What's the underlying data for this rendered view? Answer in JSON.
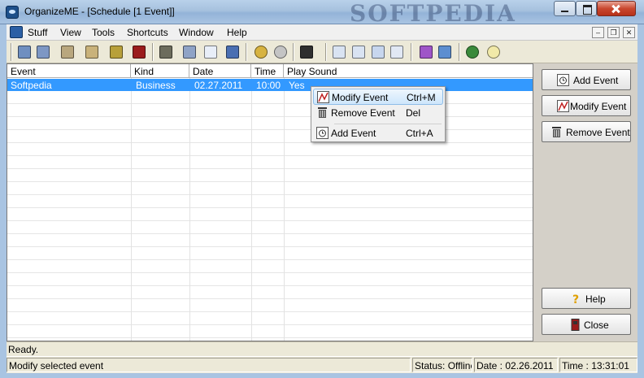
{
  "window": {
    "title": "OrganizeME - [Schedule [1 Event]]",
    "watermark": "SOFTPEDIA"
  },
  "menubar": {
    "items": [
      "Stuff",
      "View",
      "Tools",
      "Shortcuts",
      "Window",
      "Help"
    ]
  },
  "grid": {
    "columns": [
      "Event",
      "Kind",
      "Date",
      "Time",
      "Play Sound"
    ],
    "rows": [
      {
        "event": "Softpedia",
        "kind": "Business",
        "date": "02.27.2011",
        "time": "10:00",
        "sound": "Yes"
      }
    ]
  },
  "context_menu": {
    "items": [
      {
        "label": "Modify Event",
        "shortcut": "Ctrl+M",
        "icon": "modify-event-icon"
      },
      {
        "label": "Remove Event",
        "shortcut": "Del",
        "icon": "trash-icon"
      },
      {
        "label": "Add Event",
        "shortcut": "Ctrl+A",
        "icon": "add-event-icon"
      }
    ]
  },
  "side_buttons": {
    "add": "Add Event",
    "modify": "Modify Event",
    "remove": "Remove Event",
    "help": "Help",
    "close": "Close"
  },
  "status": {
    "ready": "Ready.",
    "hint": "Modify selected event",
    "connection": "Status: Offline",
    "date": "Date : 02.26.2011",
    "time": "Time : 13:31:01"
  },
  "colors": {
    "selection": "#3399ff",
    "title_gradient": "#a6c1de"
  }
}
